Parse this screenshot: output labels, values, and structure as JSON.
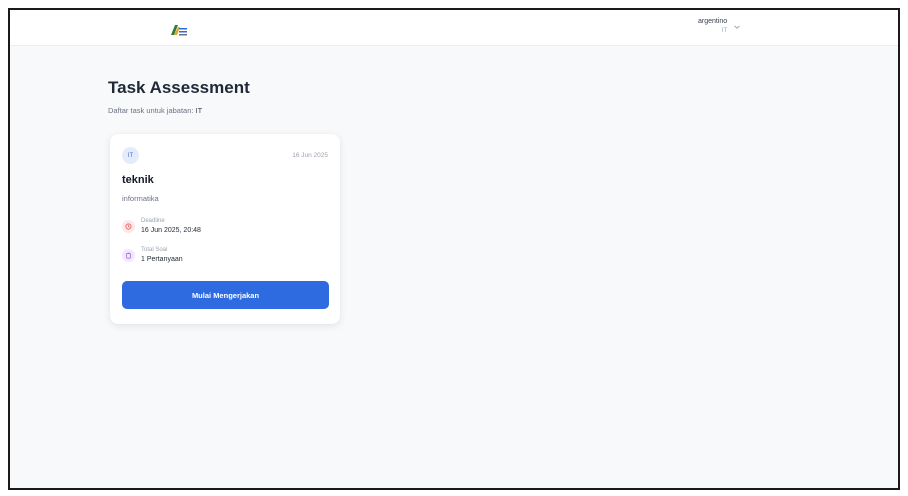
{
  "header": {
    "logo_icon": "app-logo-icon",
    "user": {
      "name": "argentino",
      "role": "IT"
    },
    "menu_icon": "chevron-down-icon"
  },
  "page": {
    "title": "Task Assessment",
    "subtitle_prefix": "Daftar task untuk jabatan: ",
    "subtitle_value": "IT"
  },
  "tasks": [
    {
      "badge": "IT",
      "date": "16 Jun 2025",
      "title": "teknik",
      "description": "informatika",
      "deadline_label": "Deadline",
      "deadline_value": "16 Jun 2025, 20:48",
      "total_label": "Total Soal",
      "total_value": "1 Pertanyaan",
      "button_label": "Mulai Mengerjakan"
    }
  ],
  "colors": {
    "primary": "#2e6ae0",
    "background": "#f8f9fb",
    "deadline_icon": "#e05252",
    "total_icon": "#9b59d6"
  }
}
